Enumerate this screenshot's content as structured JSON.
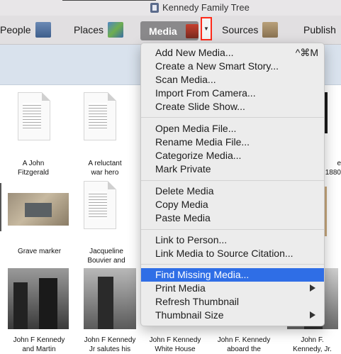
{
  "window": {
    "title": "Kennedy Family Tree"
  },
  "toolbar": {
    "people_label": "People",
    "places_label": "Places",
    "media_label": "Media",
    "sources_label": "Sources",
    "publish_label": "Publish"
  },
  "menu": {
    "groups": [
      [
        {
          "label": "Add New Media...",
          "shortcut": "^⌘M"
        },
        {
          "label": "Create a New Smart Story..."
        },
        {
          "label": "Scan Media..."
        },
        {
          "label": "Import From Camera..."
        },
        {
          "label": "Create Slide Show..."
        }
      ],
      [
        {
          "label": "Open Media File..."
        },
        {
          "label": "Rename Media File..."
        },
        {
          "label": "Categorize Media..."
        },
        {
          "label": "Mark Private"
        }
      ],
      [
        {
          "label": "Delete Media"
        },
        {
          "label": "Copy Media"
        },
        {
          "label": "Paste Media"
        }
      ],
      [
        {
          "label": "Link to Person..."
        },
        {
          "label": "Link Media to Source Citation..."
        }
      ],
      [
        {
          "label": "Find Missing Media..."
        },
        {
          "label": "Print Media"
        },
        {
          "label": "Refresh Thumbnail"
        },
        {
          "label": "Thumbnail Size"
        }
      ]
    ]
  },
  "grid": {
    "row1": [
      {
        "caption": "A John\nFitzgerald"
      },
      {
        "caption": "A reluctant\nwar hero"
      }
    ],
    "row1_edge": {
      "caption": "e\n1880"
    },
    "row2": [
      {
        "caption": "Grave marker"
      },
      {
        "caption": "Jacqueline\nBouvier and"
      }
    ],
    "row3": [
      {
        "caption": "John F Kennedy\nand Martin"
      },
      {
        "caption": "John F Kennedy\nJr salutes his"
      },
      {
        "caption": "John F Kennedy\nWhite House"
      },
      {
        "caption": "John F. Kennedy\naboard the"
      },
      {
        "caption": "John F.\nKennedy, Jr."
      }
    ]
  }
}
